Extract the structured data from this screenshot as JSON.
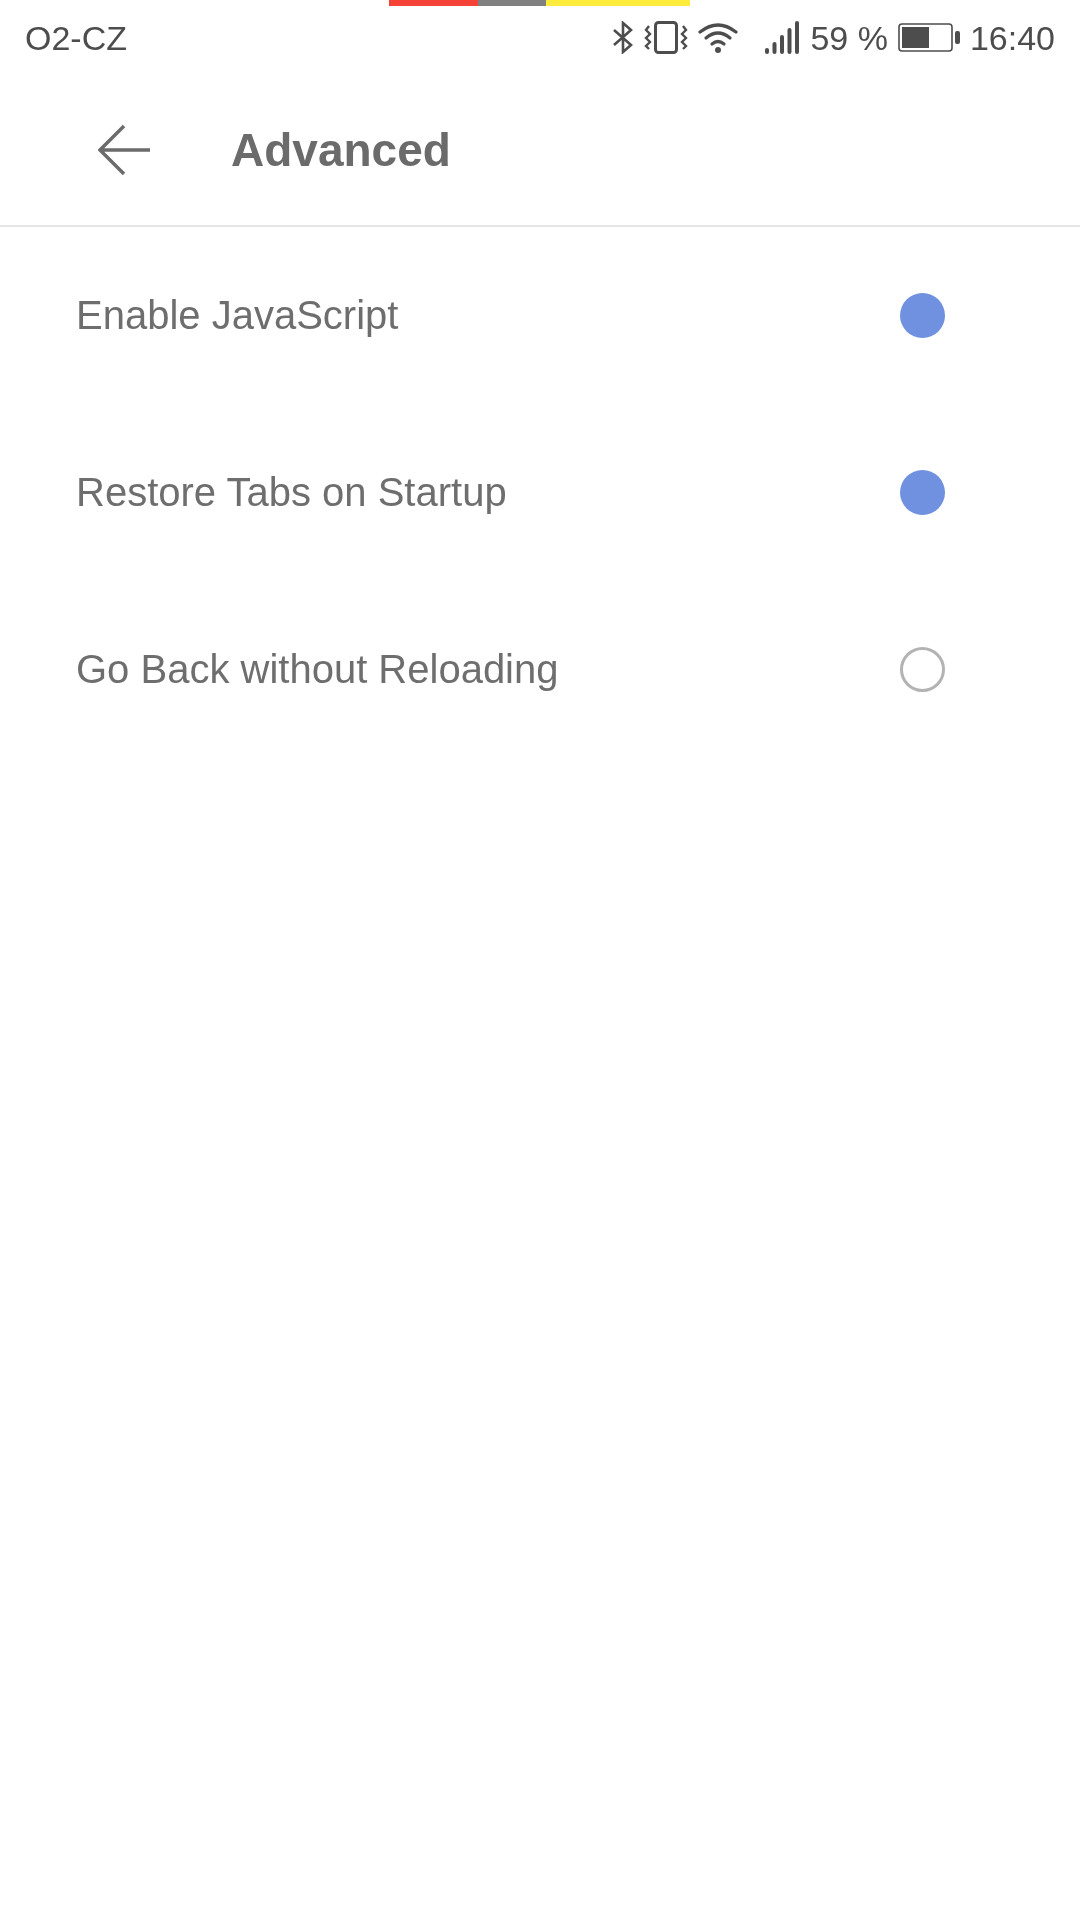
{
  "status_bar": {
    "carrier": "O2-CZ",
    "battery_percent": "59 %",
    "time": "16:40"
  },
  "header": {
    "title": "Advanced"
  },
  "settings": [
    {
      "label": "Enable JavaScript",
      "checked": true
    },
    {
      "label": "Restore Tabs on Startup",
      "checked": true
    },
    {
      "label": "Go Back without Reloading",
      "checked": false
    }
  ]
}
